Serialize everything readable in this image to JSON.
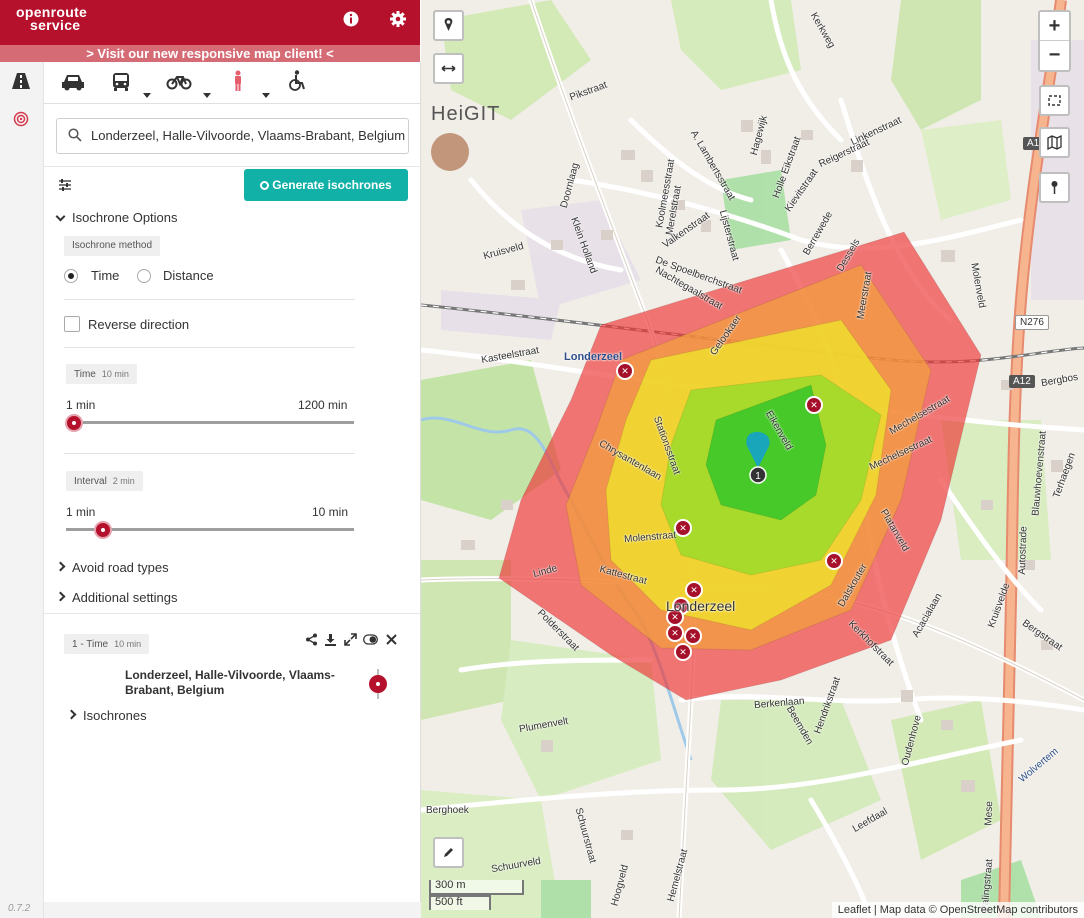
{
  "header": {
    "logo_line1": "openroute",
    "logo_line2": "service",
    "promo": "> Visit our new responsive map client! <"
  },
  "version": "0.7.2",
  "search": {
    "value": "Londerzeel, Halle-Vilvoorde, Vlaams-Brabant, Belgium"
  },
  "generate_button": "Generate isochrones",
  "isochrone_options": {
    "title": "Isochrone Options",
    "method_chip": "Isochrone method",
    "method_time": "Time",
    "method_distance": "Distance",
    "method_selected": "Time",
    "reverse_label": "Reverse direction",
    "reverse_checked": false,
    "time_chip": "Time",
    "time_value": "10 min",
    "time_min": "1 min",
    "time_max": "1200 min",
    "interval_chip": "Interval",
    "interval_value": "2 min",
    "interval_min": "1 min",
    "interval_max": "10 min"
  },
  "sections": {
    "avoid": "Avoid road types",
    "additional": "Additional settings"
  },
  "result": {
    "chip": "1 - Time",
    "chip_value": "10 min",
    "location": "Londerzeel, Halle-Vilvoorde, Vlaams-Brabant, Belgium",
    "isochrones": "Isochrones"
  },
  "map": {
    "zoom_in": "+",
    "zoom_out": "−",
    "scale_m": "300 m",
    "scale_ft": "500 ft",
    "attribution": "Leaflet | Map data © OpenStreetMap contributors",
    "brand": "HeiGIT",
    "town_label": "Londerzeel",
    "town_label_2": "Londerzeel",
    "marker_label": "1",
    "shields": [
      "N276",
      "A12",
      "A12"
    ],
    "street_labels": [
      "Pikstraat",
      "Kerkweg",
      "Doornlaag",
      "Kruisveld",
      "Klein Holland",
      "Koolmeesstraat",
      "Merelstraat",
      "Valkenstraat",
      "A. Lambertsstraat",
      "Lijsterstraat",
      "Hagewijk",
      "Holle Eikstraat",
      "Reigerstraat",
      "Linkenstraat",
      "Kievitstraat",
      "Berrewede",
      "De Spoelberchstraat",
      "Nachtegaalstraat",
      "Kasteelstraat",
      "Gelookaer",
      "Dessels",
      "Meerstraat",
      "Molenveld",
      "Eikenveld",
      "Chrysantenlaan",
      "Stationsstraat",
      "Molenstraat",
      "Mechelsestraat",
      "Platanveld",
      "Kattestraat",
      "Linde",
      "Polderstraat",
      "Dalskouter",
      "Kerkhofstraat",
      "Acacialaan",
      "Kruisvelde",
      "Bergstraat",
      "Blauwhoevenstraat",
      "Autostrade",
      "Wolvertem",
      "Berkenlaan",
      "Hendrikstraat",
      "Oudenhove",
      "Beemden",
      "Leefdaal",
      "Plumenvelt",
      "Hoogveld",
      "Schuurveld",
      "Schuurstraat",
      "Palingstraat",
      "Hemelstraat",
      "Berghoek",
      "Terhaegen",
      "Bergbos",
      "Mese",
      "Mechelsestraat"
    ]
  },
  "colors": {
    "brand": "#b5112c",
    "promo": "#d56b75",
    "accent": "#12b1a8",
    "iso_1": "#22c22a",
    "iso_2": "#8cdc2a",
    "iso_3": "#eeeb2a",
    "iso_4": "#f3a33a",
    "iso_5": "#ed3a3a"
  },
  "icons": [
    "info-icon",
    "gear-icon",
    "road-icon",
    "target-icon",
    "car-icon",
    "bus-icon",
    "bicycle-icon",
    "pedestrian-icon",
    "wheelchair-icon",
    "search-icon",
    "sliders-icon",
    "share-icon",
    "download-icon",
    "expand-icon",
    "toggle-icon",
    "close-icon",
    "marker-icon",
    "measure-icon",
    "pencil-icon",
    "fullscreen-icon",
    "map-icon",
    "pin-icon"
  ]
}
